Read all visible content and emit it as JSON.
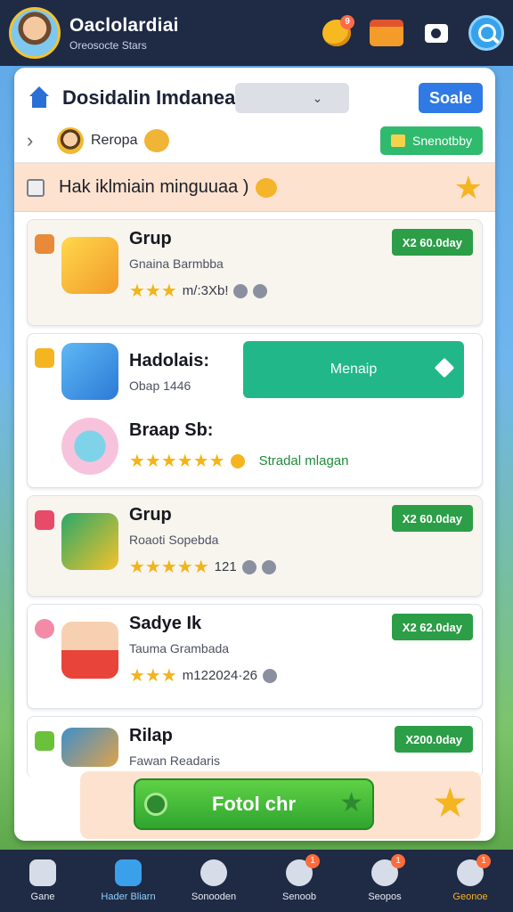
{
  "app": {
    "title": "Oaclolardiai",
    "subtitle": "Oreosocte Stars"
  },
  "topbar": {
    "notif_count": "9"
  },
  "header": {
    "title": "Dosidalin Imdanea",
    "dropdown_chevron": "⌄",
    "scale_button": "Soale",
    "region_label": "Reropa",
    "green_chip": "Snenotbby"
  },
  "banner": {
    "text": "Hak iklmiain minguuaa )",
    "star": "★"
  },
  "items": [
    {
      "title": "Grup",
      "sub": "Gnaina Barmbba",
      "stars": "★★★",
      "rating_text": "m/:3Xb!",
      "tag": "X2 60.0day"
    },
    {
      "title": "Hadolais:",
      "sub": "Obap 1446",
      "button": "Menaip"
    },
    {
      "title": "Braap Sb:",
      "stars": "★★★★★★",
      "status": "Stradal mlagan"
    },
    {
      "title": "Grup",
      "sub": "Roaoti Sopebda",
      "stars": "★★★★★",
      "rating_text": "121",
      "tag": "X2 60.0day"
    },
    {
      "title": "Sadye Ik",
      "sub": "Tauma Grambada",
      "stars": "★★★",
      "rating_text": "m122024·26",
      "tag": "X2 62.0day"
    },
    {
      "title": "Rilap",
      "sub": "Fawan Readaris",
      "tag": "X200.0day"
    }
  ],
  "play_button": "Fotol chr",
  "bottom_star": "★",
  "nav": [
    {
      "label": "Gane",
      "badge": ""
    },
    {
      "label": "Hader Bliarn",
      "badge": ""
    },
    {
      "label": "Sonooden",
      "badge": ""
    },
    {
      "label": "Senoob",
      "badge": "1"
    },
    {
      "label": "Seopos",
      "badge": "1"
    },
    {
      "label": "Geonoe",
      "badge": "1"
    }
  ],
  "colors": {
    "topbar_bg": "#1f2a44",
    "accent_blue": "#2f7ae5",
    "accent_green": "#2c9e48",
    "teal_button": "#22b788",
    "star_gold": "#f2b418"
  }
}
